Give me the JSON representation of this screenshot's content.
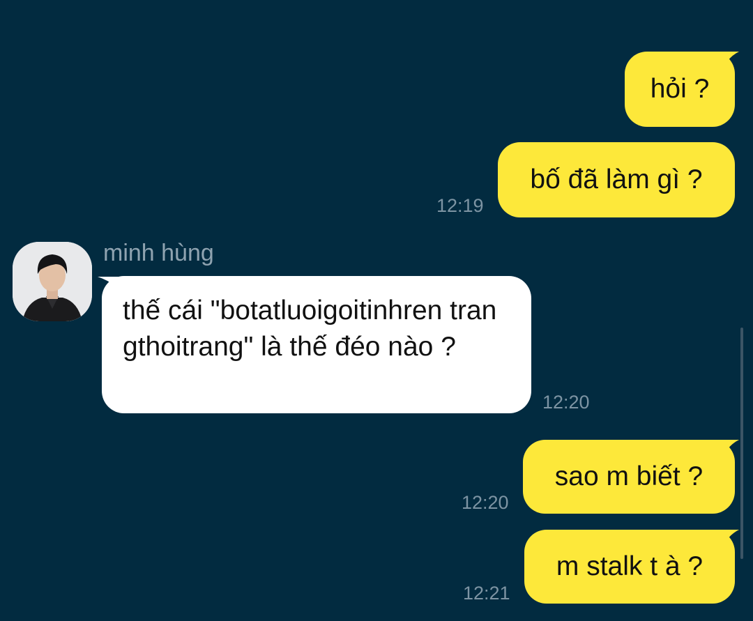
{
  "conversation": {
    "contact": {
      "name": "minh hùng",
      "avatar_icon": "person-photo-avatar"
    },
    "messages": [
      {
        "direction": "outgoing",
        "text": "hỏi ?",
        "time": ""
      },
      {
        "direction": "outgoing",
        "text": "bố đã làm gì ?",
        "time": "12:19"
      },
      {
        "direction": "incoming",
        "text": "thế cái \"botatluoigoitinhren trangthoitrang\" là thế đéo nào ?",
        "time": "12:20"
      },
      {
        "direction": "outgoing",
        "text": "sao m biết ?",
        "time": "12:20"
      },
      {
        "direction": "outgoing",
        "text": "m stalk t à ?",
        "time": "12:21"
      }
    ]
  },
  "colors": {
    "background": "#022b40",
    "outgoing_bubble": "#fde83a",
    "incoming_bubble": "#ffffff",
    "timestamp": "#7d94a3",
    "sender_name": "#8fa3b0"
  }
}
